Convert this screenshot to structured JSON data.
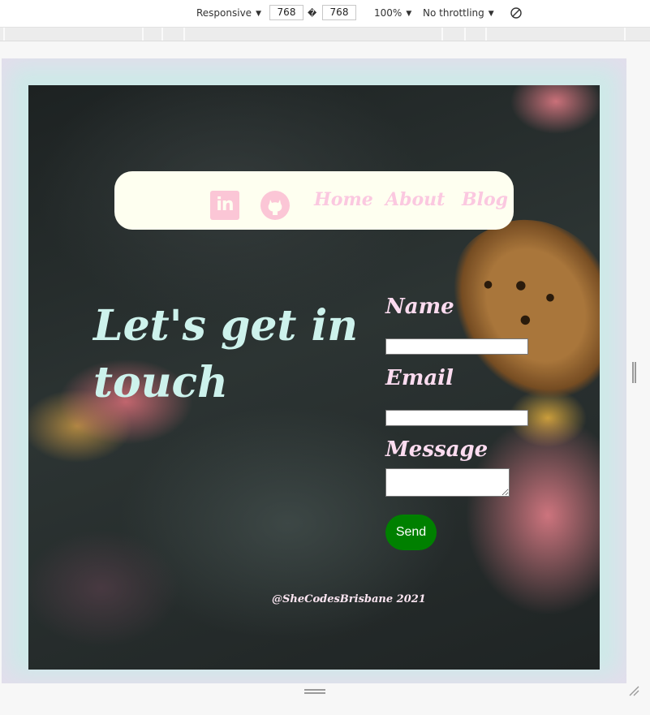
{
  "devtools": {
    "device_mode": "Responsive",
    "width": "768",
    "dimension_separator": "�",
    "height": "768",
    "zoom": "100%",
    "throttling": "No throttling",
    "caret": "▼",
    "rotate_icon": "rotate-icon"
  },
  "navbar": {
    "background": "#fefff0",
    "icons": [
      "linkedin-icon",
      "github-icon"
    ],
    "linkedin_glyph": "in",
    "links": [
      "Home",
      "About",
      "Blog"
    ]
  },
  "hero": {
    "heading": "Let's get in touch",
    "color": "#cdf2ec"
  },
  "contact_form": {
    "name_label": "Name",
    "email_label": "Email",
    "message_label": "Message",
    "name_value": "",
    "email_value": "",
    "message_value": "",
    "send_label": "Send",
    "send_color": "#008000"
  },
  "footer": {
    "credit": "@SheCodesBrisbane 2021"
  }
}
